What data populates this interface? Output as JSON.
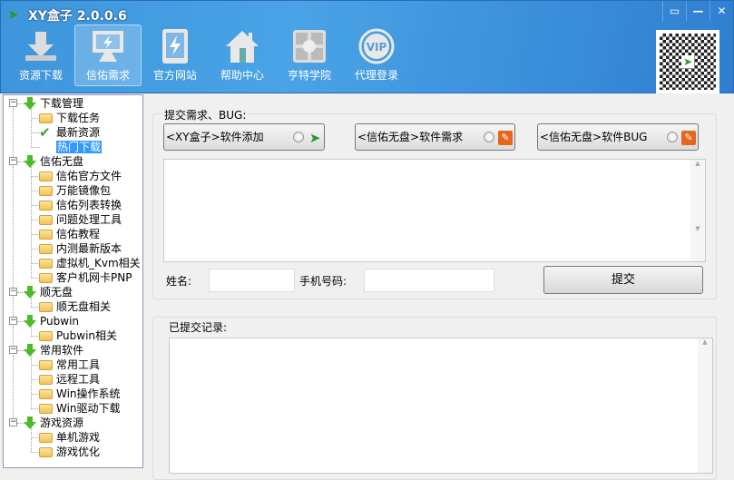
{
  "window": {
    "title": "XY盒子 2.0.0.6",
    "controls": [
      "▭",
      "—",
      "✕"
    ]
  },
  "nav": [
    {
      "label": "资源下载",
      "icon": "download-icon"
    },
    {
      "label": "信佑需求",
      "icon": "monitor-icon",
      "active": true
    },
    {
      "label": "官方网站",
      "icon": "tablet-icon"
    },
    {
      "label": "帮助中心",
      "icon": "home-icon"
    },
    {
      "label": "亨特学院",
      "icon": "college-icon"
    },
    {
      "label": "代理登录",
      "icon": "vip-icon"
    }
  ],
  "vip_text": "VIP",
  "tree": [
    {
      "label": "下载管理",
      "children": [
        {
          "label": "下载任务"
        },
        {
          "label": "最新资源",
          "icon": "check"
        },
        {
          "label": "热门下载",
          "icon": "none",
          "selected": true
        }
      ]
    },
    {
      "label": "信佑无盘",
      "children": [
        {
          "label": "信佑官方文件"
        },
        {
          "label": "万能镜像包"
        },
        {
          "label": "信佑列表转换"
        },
        {
          "label": "问题处理工具"
        },
        {
          "label": "信佑教程"
        },
        {
          "label": "内测最新版本"
        },
        {
          "label": "虚拟机_Kvm相关"
        },
        {
          "label": "客户机网卡PNP"
        }
      ]
    },
    {
      "label": "顺无盘",
      "children": [
        {
          "label": "顺无盘相关"
        }
      ]
    },
    {
      "label": "Pubwin",
      "children": [
        {
          "label": "Pubwin相关"
        }
      ]
    },
    {
      "label": "常用软件",
      "children": [
        {
          "label": "常用工具"
        },
        {
          "label": "远程工具"
        },
        {
          "label": "Win操作系统"
        },
        {
          "label": "Win驱动下载"
        }
      ]
    },
    {
      "label": "游戏资源",
      "children": [
        {
          "label": "单机游戏"
        },
        {
          "label": "游戏优化"
        }
      ]
    }
  ],
  "submit_group": {
    "label": "提交需求、BUG:",
    "options": [
      {
        "label": "<XY盒子>软件添加"
      },
      {
        "label": "<信佑无盘>软件需求"
      },
      {
        "label": "<信佑无盘>软件BUG"
      }
    ],
    "name_label": "姓名:",
    "name_value": "",
    "phone_label": "手机号码:",
    "phone_value": "",
    "submit_label": "提交"
  },
  "records_group": {
    "label": "已提交记录:"
  },
  "colors": {
    "accent": "#3d95dc",
    "selected": "#3399ff"
  }
}
